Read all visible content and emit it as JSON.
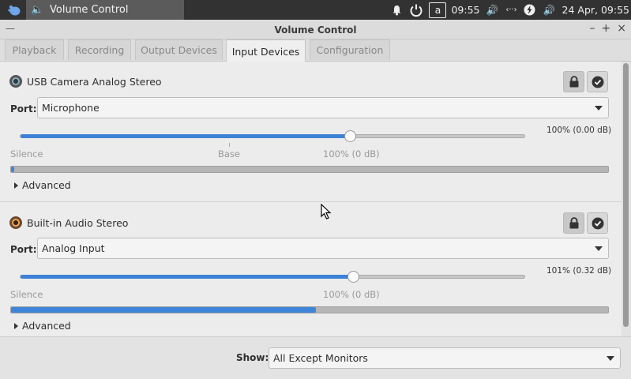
{
  "panel": {
    "task_title": "Volume Control",
    "time": "09:55",
    "date": "24 Apr, 09:55",
    "kbd_layout": "a"
  },
  "window": {
    "title": "Volume Control",
    "ctrl_min": "–",
    "ctrl_max": "+",
    "ctrl_close": "×"
  },
  "tabs": [
    {
      "label": "Playback"
    },
    {
      "label": "Recording"
    },
    {
      "label": "Output Devices"
    },
    {
      "label": "Input Devices",
      "active": true
    },
    {
      "label": "Configuration"
    }
  ],
  "devices": [
    {
      "name": "USB Camera Analog Stereo",
      "port_label": "Port:",
      "port": "Microphone",
      "volume_pct": 100,
      "volume_text": "100% (0.00 dB)",
      "marks": {
        "silence": "Silence",
        "base": "Base",
        "hundred": "100% (0 dB)"
      },
      "level_fraction": 0.005,
      "advanced": "Advanced"
    },
    {
      "name": "Built-in Audio Stereo",
      "port_label": "Port:",
      "port": "Analog Input",
      "volume_pct": 101,
      "volume_text": "101% (0.32 dB)",
      "marks": {
        "silence": "Silence",
        "hundred": "100% (0 dB)"
      },
      "level_fraction": 0.51,
      "advanced": "Advanced"
    }
  ],
  "footer": {
    "show_label": "Show:",
    "show_value": "All Except Monitors"
  },
  "colors": {
    "accent": "#3c82d6",
    "panel_bg": "#323232"
  }
}
